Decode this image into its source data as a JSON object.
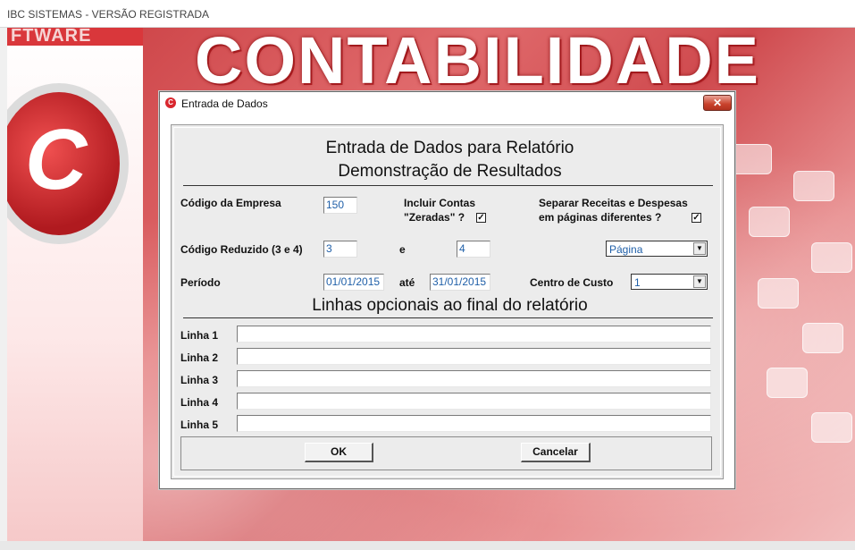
{
  "window": {
    "title": "IBC SISTEMAS - VERSÃO REGISTRADA"
  },
  "splash": {
    "software_text": "FTWARE",
    "brand": "CONTABILIDADE",
    "logo_letter": "C"
  },
  "dialog": {
    "title": "Entrada de Dados",
    "close_glyph": "✕",
    "heading_line1": "Entrada de Dados para Relatório",
    "heading_line2": "Demonstração de Resultados",
    "codigo_empresa": {
      "label": "Código da Empresa",
      "value": "150"
    },
    "incluir_contas": {
      "label_line1": "Incluir Contas",
      "label_line2": "\"Zeradas\" ?",
      "checked": true
    },
    "separar_receitas": {
      "label_line1": "Separar Receitas e Despesas",
      "label_line2": "em páginas diferentes ?",
      "checked": true
    },
    "codigo_reduzido": {
      "label": "Código Reduzido (3 e 4)",
      "from": "3",
      "connector": "e",
      "to": "4"
    },
    "pagina_select": {
      "value": "Página"
    },
    "periodo": {
      "label": "Período",
      "start": "01/01/2015",
      "connector": "até",
      "end": "31/01/2015"
    },
    "centro_custo": {
      "label": "Centro de Custo",
      "value": "1"
    },
    "optional_heading": "Linhas opcionais ao final do relatório",
    "lines": [
      {
        "label": "Linha 1",
        "value": ""
      },
      {
        "label": "Linha 2",
        "value": ""
      },
      {
        "label": "Linha 3",
        "value": ""
      },
      {
        "label": "Linha 4",
        "value": ""
      },
      {
        "label": "Linha 5",
        "value": ""
      }
    ],
    "ok_label": "OK",
    "cancel_label": "Cancelar",
    "check_glyph": "✓",
    "dropdown_glyph": "▼"
  },
  "colors": {
    "accent": "#d9373b",
    "field_text": "#1f5fa8"
  }
}
